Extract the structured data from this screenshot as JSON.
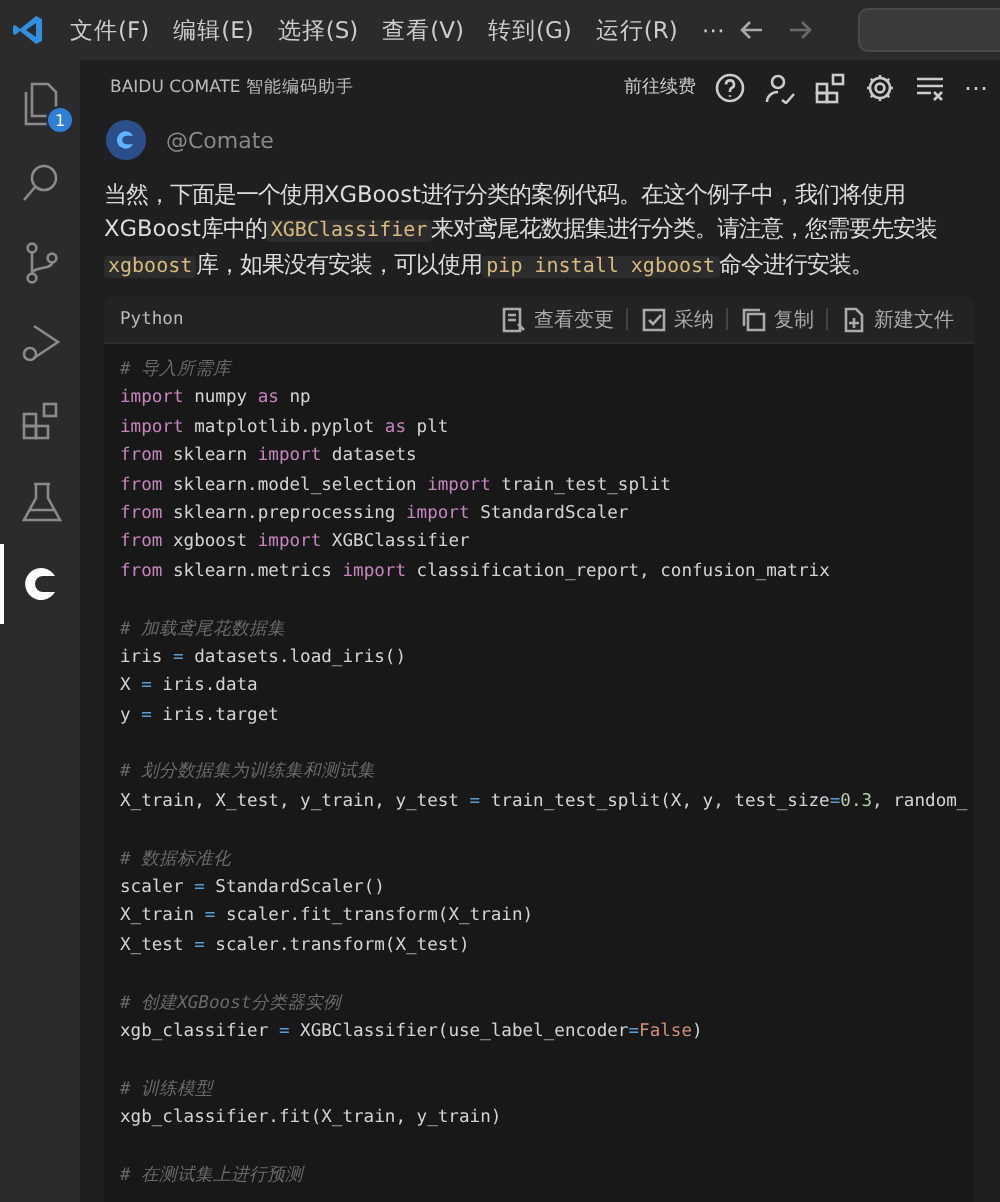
{
  "menu_bar": {
    "items": [
      "文件(F)",
      "编辑(E)",
      "选择(S)",
      "查看(V)",
      "转到(G)",
      "运行(R)",
      "⋯"
    ]
  },
  "activity_bar": {
    "items": [
      {
        "kind": "files",
        "selected": false,
        "badge": "1"
      },
      {
        "kind": "search",
        "selected": false
      },
      {
        "kind": "branch",
        "selected": false
      },
      {
        "kind": "debug",
        "selected": false
      },
      {
        "kind": "blocks",
        "selected": false
      },
      {
        "kind": "flask",
        "selected": false
      },
      {
        "kind": "comate",
        "selected": true
      }
    ]
  },
  "panel": {
    "title": "BAIDU COMATE 智能编码助手",
    "renew_link": "前往续费",
    "more": "⋯",
    "author": "@Comate",
    "message": [
      {
        "kind": "text",
        "text": "当然，下面是一个使用XGBoost进行分类的案例代码。在这个例子中，我们将使用XGBoost库中的"
      },
      {
        "kind": "code",
        "text": "XGBClassifier"
      },
      {
        "kind": "text",
        "text": "来对鸢尾花数据集进行分类。请注意，您需要先安装"
      },
      {
        "kind": "code",
        "text": "xgboost"
      },
      {
        "kind": "text",
        "text": "库，如果没有安装，可以使用"
      },
      {
        "kind": "code",
        "text": "pip install xgboost"
      },
      {
        "kind": "text",
        "text": "命令进行安装。"
      }
    ],
    "code_block": {
      "language": "Python",
      "actions": [
        {
          "kind": "diff",
          "label": "查看变更"
        },
        {
          "kind": "accept",
          "label": "采纳"
        },
        {
          "kind": "copy",
          "label": "复制"
        },
        {
          "kind": "newfile",
          "label": "新建文件"
        }
      ],
      "lines": [
        {
          "kind": "code",
          "tokens": [
            {
              "kind": "comment",
              "text": "# 导入所需库"
            }
          ]
        },
        {
          "kind": "code",
          "tokens": [
            {
              "kind": "keyword",
              "text": "import"
            },
            {
              "kind": "plain",
              "text": " numpy "
            },
            {
              "kind": "keyword",
              "text": "as"
            },
            {
              "kind": "plain",
              "text": " np"
            }
          ]
        },
        {
          "kind": "code",
          "tokens": [
            {
              "kind": "keyword",
              "text": "import"
            },
            {
              "kind": "plain",
              "text": " matplotlib.pyplot "
            },
            {
              "kind": "keyword",
              "text": "as"
            },
            {
              "kind": "plain",
              "text": " plt"
            }
          ]
        },
        {
          "kind": "code",
          "tokens": [
            {
              "kind": "keyword",
              "text": "from"
            },
            {
              "kind": "plain",
              "text": " sklearn "
            },
            {
              "kind": "keyword",
              "text": "import"
            },
            {
              "kind": "plain",
              "text": " datasets"
            }
          ]
        },
        {
          "kind": "code",
          "tokens": [
            {
              "kind": "keyword",
              "text": "from"
            },
            {
              "kind": "plain",
              "text": " sklearn.model_selection "
            },
            {
              "kind": "keyword",
              "text": "import"
            },
            {
              "kind": "plain",
              "text": " train_test_split"
            }
          ]
        },
        {
          "kind": "code",
          "tokens": [
            {
              "kind": "keyword",
              "text": "from"
            },
            {
              "kind": "plain",
              "text": " sklearn.preprocessing "
            },
            {
              "kind": "keyword",
              "text": "import"
            },
            {
              "kind": "plain",
              "text": " StandardScaler"
            }
          ]
        },
        {
          "kind": "code",
          "tokens": [
            {
              "kind": "keyword",
              "text": "from"
            },
            {
              "kind": "plain",
              "text": " xgboost "
            },
            {
              "kind": "keyword",
              "text": "import"
            },
            {
              "kind": "plain",
              "text": " XGBClassifier"
            }
          ]
        },
        {
          "kind": "code",
          "tokens": [
            {
              "kind": "keyword",
              "text": "from"
            },
            {
              "kind": "plain",
              "text": " sklearn.metrics "
            },
            {
              "kind": "keyword",
              "text": "import"
            },
            {
              "kind": "plain",
              "text": " classification_report, confusion_matrix"
            }
          ]
        },
        {
          "kind": "blank"
        },
        {
          "kind": "code",
          "tokens": [
            {
              "kind": "comment",
              "text": "# 加载鸢尾花数据集"
            }
          ]
        },
        {
          "kind": "code",
          "tokens": [
            {
              "kind": "plain",
              "text": "iris "
            },
            {
              "kind": "operator",
              "text": "="
            },
            {
              "kind": "plain",
              "text": " datasets.load_iris()"
            }
          ]
        },
        {
          "kind": "code",
          "tokens": [
            {
              "kind": "plain",
              "text": "X "
            },
            {
              "kind": "operator",
              "text": "="
            },
            {
              "kind": "plain",
              "text": " iris.data"
            }
          ]
        },
        {
          "kind": "code",
          "tokens": [
            {
              "kind": "plain",
              "text": "y "
            },
            {
              "kind": "operator",
              "text": "="
            },
            {
              "kind": "plain",
              "text": " iris.target"
            }
          ]
        },
        {
          "kind": "blank"
        },
        {
          "kind": "code",
          "tokens": [
            {
              "kind": "comment",
              "text": "# 划分数据集为训练集和测试集"
            }
          ]
        },
        {
          "kind": "code",
          "tokens": [
            {
              "kind": "plain",
              "text": "X_train, X_test, y_train, y_test "
            },
            {
              "kind": "operator",
              "text": "="
            },
            {
              "kind": "plain",
              "text": " train_test_split(X, y, test_size"
            },
            {
              "kind": "operator",
              "text": "="
            },
            {
              "kind": "number",
              "text": "0.3"
            },
            {
              "kind": "plain",
              "text": ", random_"
            }
          ]
        },
        {
          "kind": "blank"
        },
        {
          "kind": "code",
          "tokens": [
            {
              "kind": "comment",
              "text": "# 数据标准化"
            }
          ]
        },
        {
          "kind": "code",
          "tokens": [
            {
              "kind": "plain",
              "text": "scaler "
            },
            {
              "kind": "operator",
              "text": "="
            },
            {
              "kind": "plain",
              "text": " StandardScaler()"
            }
          ]
        },
        {
          "kind": "code",
          "tokens": [
            {
              "kind": "plain",
              "text": "X_train "
            },
            {
              "kind": "operator",
              "text": "="
            },
            {
              "kind": "plain",
              "text": " scaler.fit_transform(X_train)"
            }
          ]
        },
        {
          "kind": "code",
          "tokens": [
            {
              "kind": "plain",
              "text": "X_test "
            },
            {
              "kind": "operator",
              "text": "="
            },
            {
              "kind": "plain",
              "text": " scaler.transform(X_test)"
            }
          ]
        },
        {
          "kind": "blank"
        },
        {
          "kind": "code",
          "tokens": [
            {
              "kind": "comment",
              "text": "# 创建XGBoost分类器实例"
            }
          ]
        },
        {
          "kind": "code",
          "tokens": [
            {
              "kind": "plain",
              "text": "xgb_classifier "
            },
            {
              "kind": "operator",
              "text": "="
            },
            {
              "kind": "plain",
              "text": " XGBClassifier(use_label_encoder"
            },
            {
              "kind": "operator",
              "text": "="
            },
            {
              "kind": "constant",
              "text": "False"
            },
            {
              "kind": "plain",
              "text": ")"
            }
          ]
        },
        {
          "kind": "blank"
        },
        {
          "kind": "code",
          "tokens": [
            {
              "kind": "comment",
              "text": "# 训练模型"
            }
          ]
        },
        {
          "kind": "code",
          "tokens": [
            {
              "kind": "plain",
              "text": "xgb_classifier.fit(X_train, y_train)"
            }
          ]
        },
        {
          "kind": "blank"
        },
        {
          "kind": "code",
          "tokens": [
            {
              "kind": "comment",
              "text": "# 在测试集上进行预测"
            }
          ]
        }
      ]
    }
  }
}
